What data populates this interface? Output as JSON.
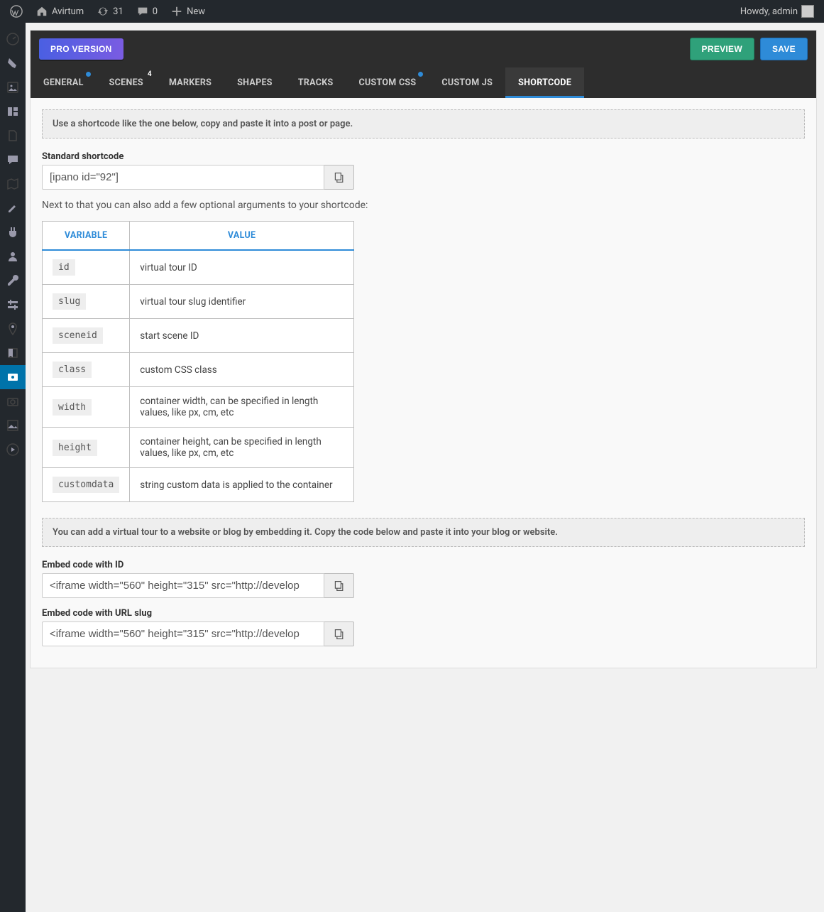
{
  "topbar": {
    "site_name": "Avirtum",
    "updates_count": "31",
    "comments_count": "0",
    "new_label": "New",
    "howdy": "Howdy, admin"
  },
  "panel": {
    "pro_label": "PRO VERSION",
    "preview_label": "PREVIEW",
    "save_label": "SAVE"
  },
  "tabs": [
    {
      "label": "GENERAL",
      "dot": true
    },
    {
      "label": "SCENES",
      "badge": "4"
    },
    {
      "label": "MARKERS"
    },
    {
      "label": "SHAPES"
    },
    {
      "label": "TRACKS"
    },
    {
      "label": "CUSTOM CSS",
      "dot": true
    },
    {
      "label": "CUSTOM JS"
    },
    {
      "label": "SHORTCODE",
      "active": true
    }
  ],
  "shortcode": {
    "info1": "Use a shortcode like the one below, copy and paste it into a post or page.",
    "std_label": "Standard shortcode",
    "std_value": "[ipano id=\"92\"]",
    "args_note": "Next to that you can also add a few optional arguments to your shortcode:",
    "th_var": "VARIABLE",
    "th_val": "VALUE",
    "rows": [
      {
        "var": "id",
        "val": "virtual tour ID"
      },
      {
        "var": "slug",
        "val": "virtual tour slug identifier"
      },
      {
        "var": "sceneid",
        "val": "start scene ID"
      },
      {
        "var": "class",
        "val": "custom CSS class"
      },
      {
        "var": "width",
        "val": "container width, can be specified in length values, like px, cm, etc"
      },
      {
        "var": "height",
        "val": "container height, can be specified in length values, like px, cm, etc"
      },
      {
        "var": "customdata",
        "val": "string custom data is applied to the container"
      }
    ],
    "info2": "You can add a virtual tour to a website or blog by embedding it. Copy the code below and paste it into your blog or website.",
    "embed_id_label": "Embed code with ID",
    "embed_id_value": "<iframe width=\"560\" height=\"315\" src=\"http://develop",
    "embed_slug_label": "Embed code with URL slug",
    "embed_slug_value": "<iframe width=\"560\" height=\"315\" src=\"http://develop"
  }
}
